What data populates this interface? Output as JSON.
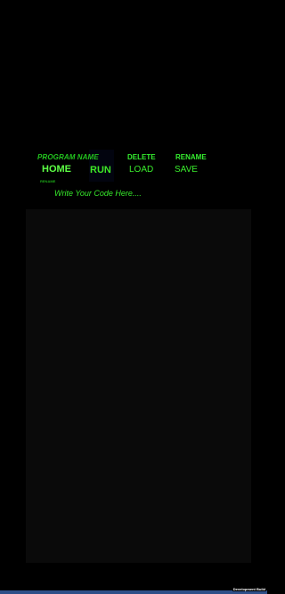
{
  "header": {
    "program_name_label": "PROGRAM NAME",
    "delete_label": "DELETE",
    "rename_label": "RENAME",
    "rename_small_label": "RENAME"
  },
  "toolbar": {
    "home_label": "HOME",
    "run_label": "RUN",
    "load_label": "LOAD",
    "save_label": "SAVE"
  },
  "editor": {
    "placeholder": "Write Your Code Here...."
  },
  "footer": {
    "build_label": "Development Build"
  },
  "colors": {
    "background": "#000000",
    "accent_green": "#39ec2c",
    "editor_background": "#0a0a0a",
    "footer_bar": "#2e4f88"
  }
}
